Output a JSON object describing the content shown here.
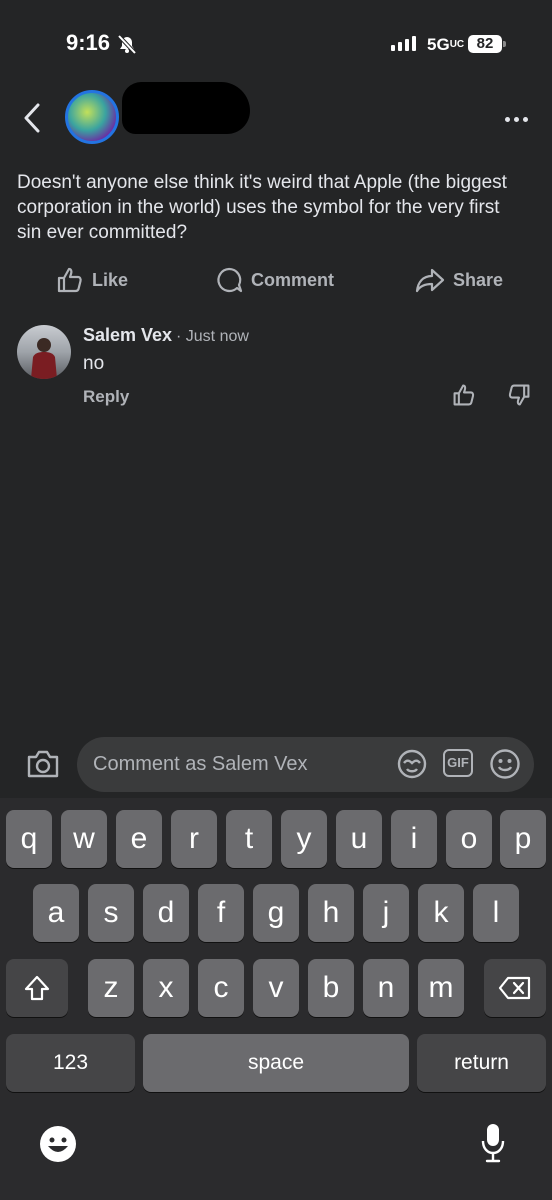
{
  "status_bar": {
    "time": "9:16",
    "network": "5G",
    "network_suffix": "UC",
    "battery": "82"
  },
  "post": {
    "text": "Doesn't anyone else think it's weird that Apple (the biggest corporation in the world) uses the symbol for the very first sin ever committed?",
    "actions": {
      "like": "Like",
      "comment": "Comment",
      "share": "Share"
    }
  },
  "comment": {
    "author": "Salem Vex",
    "time": "· Just now",
    "text": "no",
    "reply": "Reply"
  },
  "composer": {
    "placeholder": "Comment as Salem Vex",
    "gif_label": "GIF"
  },
  "keyboard": {
    "row1": [
      "q",
      "w",
      "e",
      "r",
      "t",
      "y",
      "u",
      "i",
      "o",
      "p"
    ],
    "row2": [
      "a",
      "s",
      "d",
      "f",
      "g",
      "h",
      "j",
      "k",
      "l"
    ],
    "row3": [
      "z",
      "x",
      "c",
      "v",
      "b",
      "n",
      "m"
    ],
    "numbers": "123",
    "space": "space",
    "return": "return"
  },
  "icons": [
    "bell-slash-icon",
    "signal-icon",
    "battery-icon",
    "back-icon",
    "more-icon",
    "like-icon",
    "comment-icon",
    "share-icon",
    "thumbs-up-icon",
    "thumbs-down-icon",
    "camera-icon",
    "avatar-sticker-icon",
    "gif-icon",
    "smiley-icon",
    "shift-icon",
    "delete-icon",
    "emoji-icon",
    "microphone-icon"
  ]
}
